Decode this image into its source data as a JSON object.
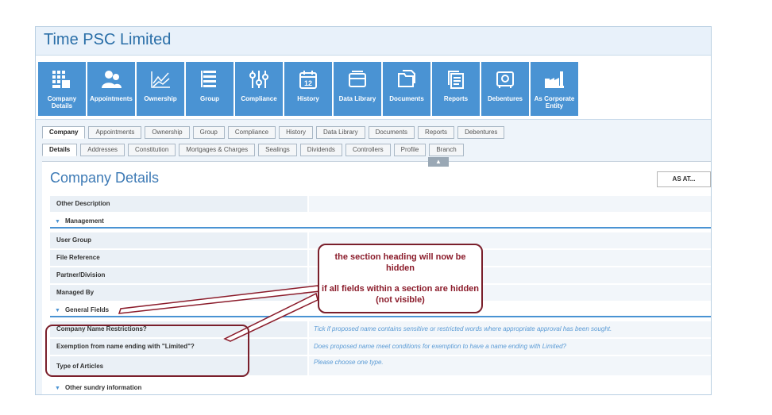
{
  "app": {
    "title": "Time PSC Limited"
  },
  "toolbar": {
    "tiles": [
      {
        "label": "Company\nDetails",
        "icon": "building-icon"
      },
      {
        "label": "Appointments",
        "icon": "people-icon"
      },
      {
        "label": "Ownership",
        "icon": "chart-line-icon"
      },
      {
        "label": "Group",
        "icon": "list-icon"
      },
      {
        "label": "Compliance",
        "icon": "sliders-icon"
      },
      {
        "label": "History",
        "icon": "calendar-icon"
      },
      {
        "label": "Data Library",
        "icon": "drawer-icon"
      },
      {
        "label": "Documents",
        "icon": "folder-icon"
      },
      {
        "label": "Reports",
        "icon": "report-icon"
      },
      {
        "label": "Debentures",
        "icon": "safe-icon"
      },
      {
        "label": "As Corporate\nEntity",
        "icon": "factory-icon"
      }
    ]
  },
  "tabs": [
    "Company",
    "Appointments",
    "Ownership",
    "Group",
    "Compliance",
    "History",
    "Data Library",
    "Documents",
    "Reports",
    "Debentures"
  ],
  "subtabs": [
    "Details",
    "Addresses",
    "Constitution",
    "Mortgages & Charges",
    "Sealings",
    "Dividends",
    "Controllers",
    "Profile",
    "Branch"
  ],
  "content": {
    "title": "Company Details",
    "as_at": "AS AT...",
    "other_description": "Other Description",
    "management": {
      "heading": "Management",
      "fields": [
        "User Group",
        "File Reference",
        "Partner/Division",
        "Managed By"
      ]
    },
    "general": {
      "heading": "General Fields",
      "fields": [
        {
          "label": "Company Name Restrictions?",
          "hint": "Tick if proposed name contains sensitive or restricted words where appropriate approval has been sought."
        },
        {
          "label": "Exemption from name ending with \"Limited\"?",
          "hint": "Does proposed name meet conditions for exemption to have a name ending with Limited?"
        },
        {
          "label": "Type of Articles",
          "hint": "Please choose one type."
        }
      ]
    },
    "other_sundry": "Other sundry information"
  },
  "callout": {
    "line1": "the section heading will now be hidden",
    "line2": "if all fields within a section are hidden (not visible)"
  },
  "colors": {
    "accent": "#4a93d3",
    "callout": "#8b1c2b",
    "title": "#2a6fa8"
  }
}
